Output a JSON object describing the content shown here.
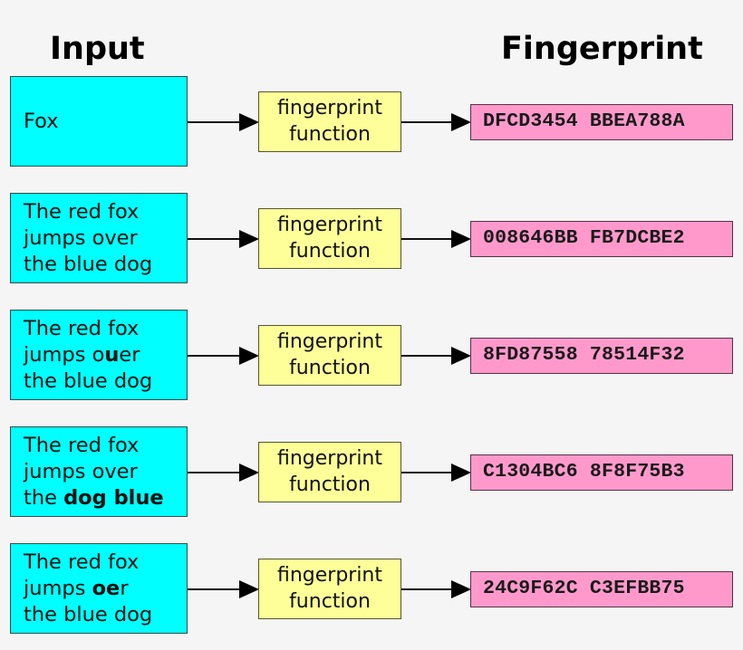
{
  "headings": {
    "input": "Input",
    "fingerprint": "Fingerprint"
  },
  "colors": {
    "input_box": "#00ffff",
    "function_box": "#ffff99",
    "fingerprint_box": "#ff99cc",
    "background": "#f5f5f5"
  },
  "function_label": {
    "line1": "fingerprint",
    "line2": "function"
  },
  "rows": [
    {
      "input_lines": [
        [
          {
            "t": "Fox",
            "b": false
          }
        ]
      ],
      "fingerprint": "DFCD3454 BBEA788A"
    },
    {
      "input_lines": [
        [
          {
            "t": "The red fox",
            "b": false
          }
        ],
        [
          {
            "t": "jumps over",
            "b": false
          }
        ],
        [
          {
            "t": "the blue dog",
            "b": false
          }
        ]
      ],
      "fingerprint": "008646BB FB7DCBE2"
    },
    {
      "input_lines": [
        [
          {
            "t": "The red fox",
            "b": false
          }
        ],
        [
          {
            "t": "jumps o",
            "b": false
          },
          {
            "t": "u",
            "b": true
          },
          {
            "t": "er",
            "b": false
          }
        ],
        [
          {
            "t": "the blue dog",
            "b": false
          }
        ]
      ],
      "fingerprint": "8FD87558 78514F32"
    },
    {
      "input_lines": [
        [
          {
            "t": "The red fox",
            "b": false
          }
        ],
        [
          {
            "t": "jumps over",
            "b": false
          }
        ],
        [
          {
            "t": "the ",
            "b": false
          },
          {
            "t": "dog blue",
            "b": true
          }
        ]
      ],
      "fingerprint": "C1304BC6 8F8F75B3"
    },
    {
      "input_lines": [
        [
          {
            "t": "The red fox",
            "b": false
          }
        ],
        [
          {
            "t": "jumps ",
            "b": false
          },
          {
            "t": "oe",
            "b": true
          },
          {
            "t": "r",
            "b": false
          }
        ],
        [
          {
            "t": "the blue dog",
            "b": false
          }
        ]
      ],
      "fingerprint": "24C9F62C C3EFBB75"
    }
  ]
}
